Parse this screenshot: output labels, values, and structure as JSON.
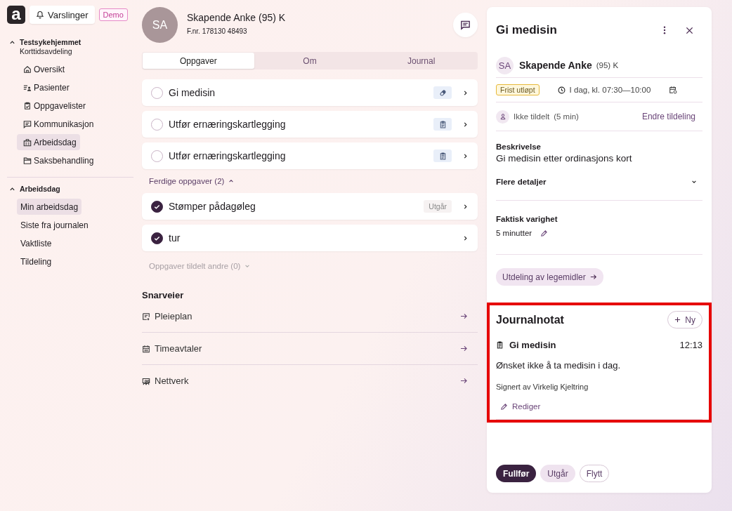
{
  "header": {
    "logo": "a",
    "notifications": "Varslinger",
    "badge": "Demo"
  },
  "sidebar": {
    "sections": [
      {
        "title": "Testsykehjemmet",
        "subtitle": "Korttidsavdeling",
        "expanded": true,
        "items": [
          {
            "label": "Oversikt",
            "selected": false
          },
          {
            "label": "Pasienter",
            "selected": false
          },
          {
            "label": "Oppgavelister",
            "selected": false
          },
          {
            "label": "Kommunikasjon",
            "selected": false
          },
          {
            "label": "Arbeidsdag",
            "selected": true
          },
          {
            "label": "Saksbehandling",
            "selected": false
          }
        ]
      },
      {
        "title": "Arbeidsdag",
        "expanded": true,
        "items": [
          {
            "label": "Min arbeidsdag",
            "selected": true
          },
          {
            "label": "Siste fra journalen",
            "selected": false
          },
          {
            "label": "Vaktliste",
            "selected": false
          },
          {
            "label": "Tildeling",
            "selected": false
          }
        ]
      }
    ]
  },
  "patient": {
    "initials": "SA",
    "name": "Skapende Anke (95) K",
    "id": "F.nr. 178130 48493"
  },
  "tabs": [
    {
      "label": "Oppgaver",
      "selected": true
    },
    {
      "label": "Om",
      "selected": false
    },
    {
      "label": "Journal",
      "selected": false
    }
  ],
  "tasks": [
    {
      "title": "Gi medisin",
      "done": false,
      "kind": "medication"
    },
    {
      "title": "Utfør ernæringskartlegging",
      "done": false,
      "kind": "form"
    },
    {
      "title": "Utfør ernæringskartlegging",
      "done": false,
      "kind": "form"
    }
  ],
  "completed": {
    "label": "Ferdige oppgaver (2)",
    "expanded": true,
    "tasks": [
      {
        "title": "Stømper pådagøleg",
        "done": true,
        "tag": "Utgår"
      },
      {
        "title": "tur",
        "done": true
      }
    ]
  },
  "assigned_others": {
    "label": "Oppgaver tildelt andre (0)",
    "expanded": false
  },
  "shortcuts": {
    "title": "Snarveier",
    "items": [
      "Pleieplan",
      "Timeavtaler",
      "Nettverk"
    ]
  },
  "detail": {
    "title": "Gi medisin",
    "patient_initials": "SA",
    "patient_name": "Skapende Anke",
    "patient_info": "(95) K",
    "status": "Frist utløpt",
    "time": "I dag, kl. 07:30—10:00",
    "assignee": "Ikke tildelt",
    "duration": "(5 min)",
    "change_assignment": "Endre tildeling",
    "description_label": "Beskrivelse",
    "description": "Gi medisin etter ordinasjons kort",
    "more_details": {
      "label": "Flere detaljer",
      "expanded": false
    },
    "actual_duration_label": "Faktisk varighet",
    "actual_duration": "5 minutter",
    "link_button": "Utdeling av legemidler",
    "journal": {
      "title": "Journalnotat",
      "new_button": "Ny",
      "note_title": "Gi medisin",
      "note_time": "12:13",
      "note_text": "Ønsket ikke å ta medisin i dag.",
      "signed": "Signert av Virkelig Kjeltring",
      "edit": "Rediger"
    },
    "actions": [
      {
        "label": "Fullfør",
        "kind": "primary"
      },
      {
        "label": "Utgår",
        "kind": "secondary"
      },
      {
        "label": "Flytt",
        "kind": "outline"
      }
    ]
  }
}
